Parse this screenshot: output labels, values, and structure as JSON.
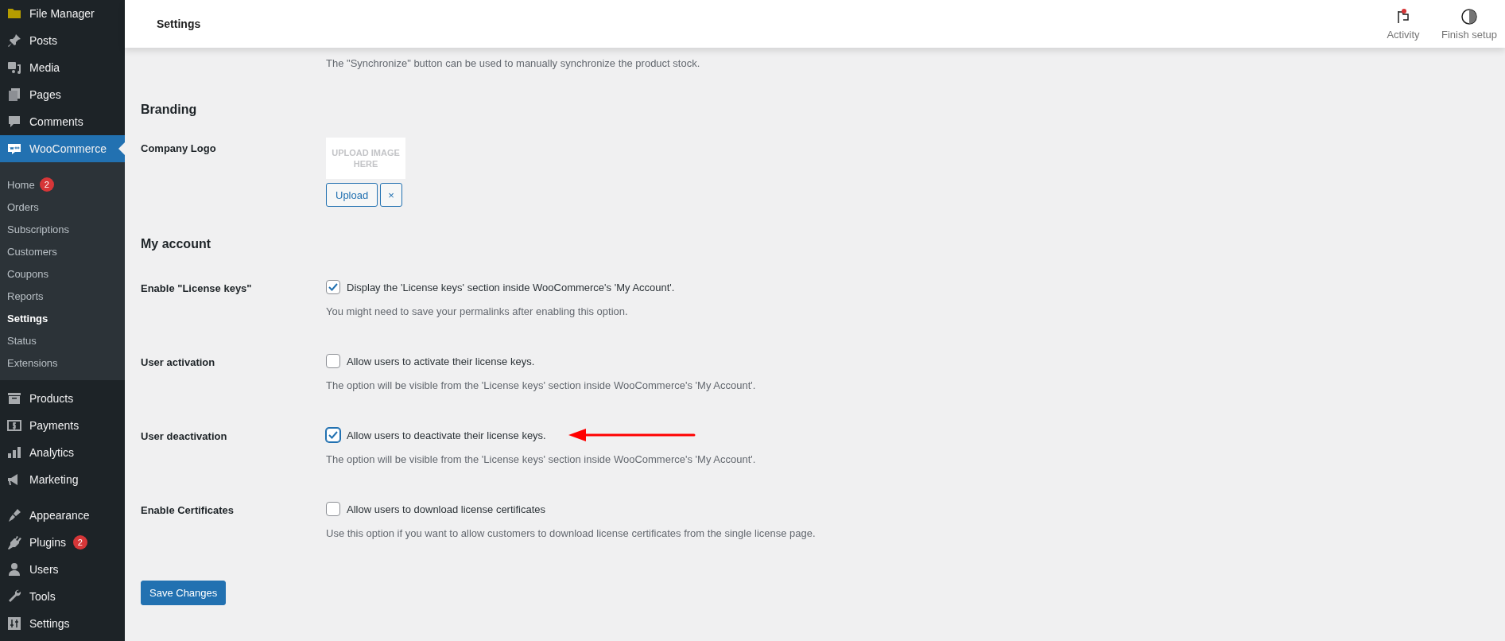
{
  "sidebar": {
    "items": [
      {
        "label": "File Manager",
        "selected": false
      },
      {
        "label": "Posts",
        "selected": false
      },
      {
        "label": "Media",
        "selected": false
      },
      {
        "label": "Pages",
        "selected": false
      },
      {
        "label": "Comments",
        "selected": false
      },
      {
        "label": "WooCommerce",
        "selected": true,
        "children": [
          {
            "label": "Home",
            "badge": "2",
            "selected": false
          },
          {
            "label": "Orders",
            "selected": false
          },
          {
            "label": "Subscriptions",
            "selected": false
          },
          {
            "label": "Customers",
            "selected": false
          },
          {
            "label": "Coupons",
            "selected": false
          },
          {
            "label": "Reports",
            "selected": false
          },
          {
            "label": "Settings",
            "selected": true
          },
          {
            "label": "Status",
            "selected": false
          },
          {
            "label": "Extensions",
            "selected": false
          }
        ]
      },
      {
        "label": "Products",
        "selected": false
      },
      {
        "label": "Payments",
        "selected": false
      },
      {
        "label": "Analytics",
        "selected": false
      },
      {
        "label": "Marketing",
        "selected": false
      },
      {
        "label": "Appearance",
        "selected": false,
        "gap": true
      },
      {
        "label": "Plugins",
        "badge": "2",
        "selected": false
      },
      {
        "label": "Users",
        "selected": false
      },
      {
        "label": "Tools",
        "selected": false
      },
      {
        "label": "Settings",
        "selected": false
      }
    ]
  },
  "header": {
    "title": "Settings",
    "actions": [
      {
        "label": "Activity",
        "notify": true
      },
      {
        "label": "Finish setup",
        "notify": false
      }
    ]
  },
  "intro_text": "The \"Synchronize\" button can be used to manually synchronize the product stock.",
  "sections": [
    {
      "title": "Branding",
      "fields": [
        {
          "kind": "logo",
          "label": "Company Logo",
          "placeholder": "UPLOAD IMAGE HERE",
          "buttons": [
            "Upload",
            "×"
          ]
        }
      ]
    },
    {
      "title": "My account",
      "fields": [
        {
          "kind": "checkbox",
          "label": "Enable \"License keys\"",
          "option": "Display the 'License keys' section inside WooCommerce's 'My Account'.",
          "checked": true,
          "highlighted": false,
          "description": "You might need to save your permalinks after enabling this option."
        },
        {
          "kind": "checkbox",
          "label": "User activation",
          "option": "Allow users to activate their license keys.",
          "checked": false,
          "highlighted": false,
          "description": "The option will be visible from the 'License keys' section inside WooCommerce's 'My Account'."
        },
        {
          "kind": "checkbox",
          "label": "User deactivation",
          "option": "Allow users to deactivate their license keys.",
          "checked": true,
          "highlighted": true,
          "description": "The option will be visible from the 'License keys' section inside WooCommerce's 'My Account'."
        },
        {
          "kind": "checkbox",
          "label": "Enable Certificates",
          "option": "Allow users to download license certificates",
          "checked": false,
          "highlighted": false,
          "description": "Use this option if you want to allow customers to download license certificates from the single license page."
        }
      ]
    }
  ],
  "save_button": "Save Changes"
}
